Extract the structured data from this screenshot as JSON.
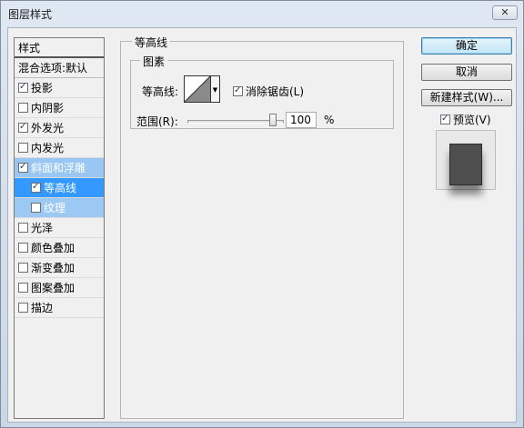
{
  "window": {
    "title": "图层样式",
    "close_label": "✕"
  },
  "style_list": {
    "header": "样式",
    "items": [
      {
        "label": "混合选项:默认",
        "checkbox": false
      },
      {
        "label": "投影",
        "checkbox": true,
        "checked": true
      },
      {
        "label": "内阴影",
        "checkbox": true,
        "checked": false
      },
      {
        "label": "外发光",
        "checkbox": true,
        "checked": true
      },
      {
        "label": "内发光",
        "checkbox": true,
        "checked": false
      },
      {
        "label": "斜面和浮雕",
        "checkbox": true,
        "checked": true
      },
      {
        "label": "等高线",
        "checkbox": true,
        "checked": true
      },
      {
        "label": "纹理",
        "checkbox": true,
        "checked": false
      },
      {
        "label": "光泽",
        "checkbox": true,
        "checked": false
      },
      {
        "label": "颜色叠加",
        "checkbox": true,
        "checked": false
      },
      {
        "label": "渐变叠加",
        "checkbox": true,
        "checked": false
      },
      {
        "label": "图案叠加",
        "checkbox": true,
        "checked": false
      },
      {
        "label": "描边",
        "checkbox": true,
        "checked": false
      }
    ]
  },
  "panel": {
    "title": "等高线",
    "group_title": "图素",
    "contour_label": "等高线:",
    "antialias_label": "消除锯齿(L)",
    "antialias_checked": true,
    "range_label": "范围(R):",
    "range_value": "100",
    "range_unit": "%"
  },
  "buttons": {
    "ok": "确定",
    "cancel": "取消",
    "new_style": "新建样式(W)..."
  },
  "preview": {
    "label": "预览(V)",
    "checked": true
  },
  "colors": {
    "selection": "#3399ff",
    "selection_light": "#99c6f2"
  }
}
